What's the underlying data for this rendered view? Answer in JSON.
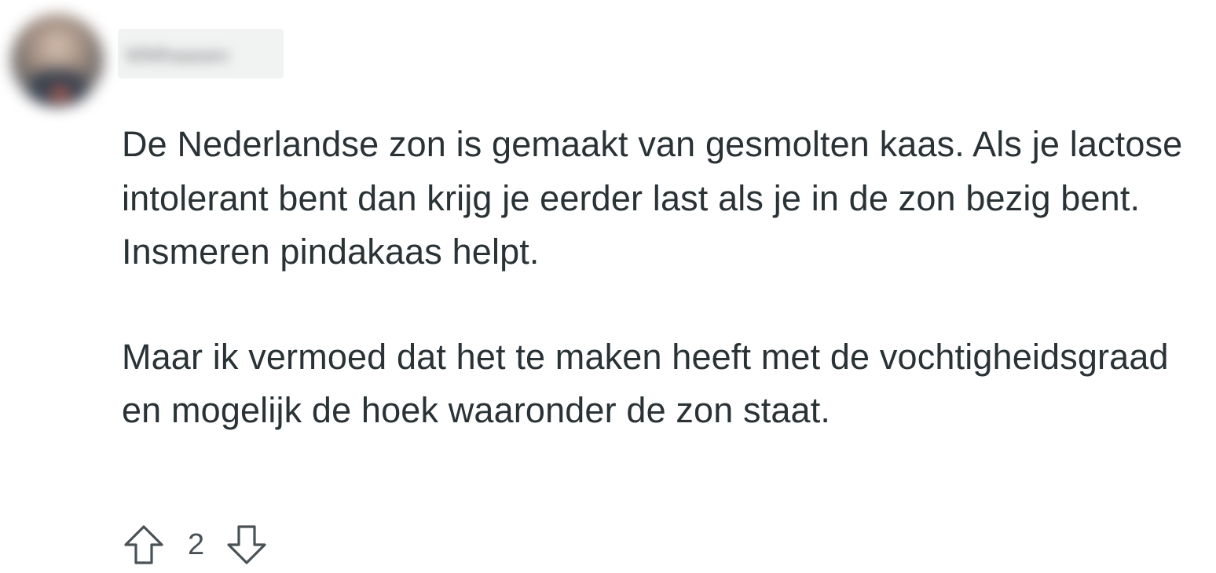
{
  "comment": {
    "author": {
      "username": "WMhaasen",
      "avatar_icon": "user-avatar"
    },
    "paragraphs": [
      "De Nederlandse zon is gemaakt van gesmolten kaas. Als je lactose intolerant bent dan krijg je eerder last als je in de zon bezig bent. Insmeren pindakaas helpt.",
      "Maar ik vermoed dat het te maken heeft met de vochtigheidsgraad en mogelijk de hoek waaronder de zon staat."
    ],
    "votes": {
      "score": "2",
      "upvote_icon": "arrow-up-icon",
      "downvote_icon": "arrow-down-icon"
    }
  },
  "colors": {
    "text": "#2a3236",
    "icon_stroke": "#4a5256",
    "background": "#ffffff"
  }
}
